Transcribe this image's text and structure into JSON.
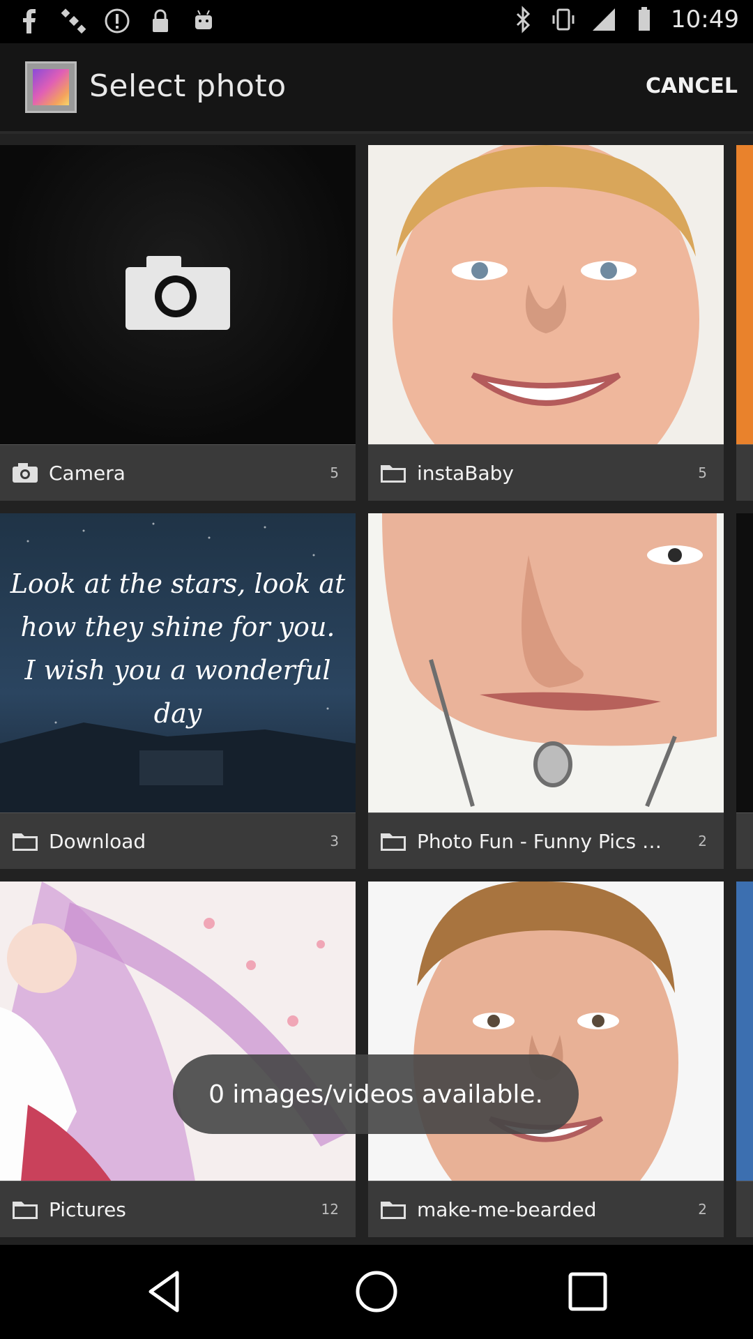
{
  "status": {
    "time": "10:49",
    "left_icons": [
      "facebook-icon",
      "satellite-icon",
      "alert-icon",
      "lock-icon",
      "android-icon"
    ],
    "right_icons": [
      "bluetooth-icon",
      "vibrate-icon",
      "signal-icon",
      "battery-icon"
    ]
  },
  "header": {
    "title": "Select photo",
    "cancel_label": "CANCEL"
  },
  "albums": [
    {
      "name": "Camera",
      "count": "5",
      "icon": "camera-icon"
    },
    {
      "name": "instaBaby",
      "count": "5",
      "icon": "folder-icon"
    },
    {
      "name": "Download",
      "count": "3",
      "icon": "folder-icon"
    },
    {
      "name": "Photo Fun - Funny Pics Cr...",
      "count": "2",
      "icon": "folder-icon"
    },
    {
      "name": "Pictures",
      "count": "12",
      "icon": "folder-icon"
    },
    {
      "name": "make-me-bearded",
      "count": "2",
      "icon": "folder-icon"
    }
  ],
  "download_thumb_text": [
    "Look at the stars, look at",
    "how they shine for you.",
    "I wish you a wonderful day"
  ],
  "toast": {
    "message": "0 images/videos available."
  },
  "navbar": {
    "icons": [
      "back-icon",
      "home-icon",
      "recents-icon"
    ]
  },
  "colors": {
    "actionbar": "#151515",
    "label_bar": "#3a3a3a",
    "toast": "#464646"
  }
}
